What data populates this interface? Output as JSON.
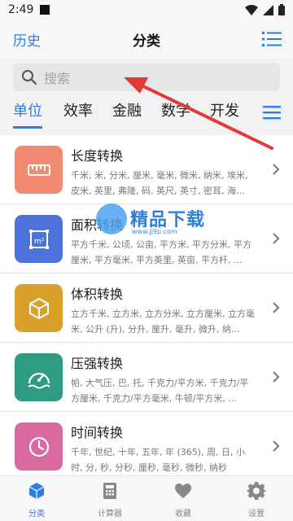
{
  "status": {
    "time": "2:49"
  },
  "header": {
    "history_label": "历史",
    "title": "分类",
    "list_icon": "list-icon"
  },
  "search": {
    "placeholder": "搜索"
  },
  "tabs": [
    "单位",
    "效率",
    "金融",
    "数学",
    "开发"
  ],
  "items": [
    {
      "title": "长度转换",
      "desc": "千米, 米, 分米, 厘米, 毫米, 微米, 纳米, 埃米, 皮米, 英里, 弗隆, 码, 英尺, 英寸, 密耳, 海...",
      "color": "#f08a72",
      "icon": "ruler-icon"
    },
    {
      "title": "面积转换",
      "desc": "平方千米, 公顷, 公亩, 平方米, 平方分米, 平方厘米, 平方毫米, 平方英里, 英亩, 平方杆, ...",
      "color": "#4d72d9",
      "icon": "area-icon"
    },
    {
      "title": "体积转换",
      "desc": "立方千米, 立方米, 立方分米, 立方厘米, 立方毫米, 公升 (升), 分升, 厘升, 毫升, 微升, 纳...",
      "color": "#d9a02b",
      "icon": "cube-icon"
    },
    {
      "title": "压强转换",
      "desc": "帕, 大气压, 巴, 托, 千克力/平方米, 千克力/平方厘米, 千克力/平方毫米, 牛顿/平方米, ...",
      "color": "#2e9c82",
      "icon": "gauge-icon"
    },
    {
      "title": "时间转换",
      "desc": "千年, 世纪, 十年, 五年, 年 (365), 周, 日, 小时, 分, 秒, 分秒, 厘秒, 毫秒, 微秒, 纳秒",
      "color": "#d9699f",
      "icon": "clock-icon"
    }
  ],
  "watermark": {
    "text": "精品下载",
    "url": "www.jj9p.com"
  },
  "nav": [
    {
      "label": "分类",
      "icon": "cube-icon"
    },
    {
      "label": "计算器",
      "icon": "calculator-icon"
    },
    {
      "label": "收藏",
      "icon": "heart-icon"
    },
    {
      "label": "设置",
      "icon": "gear-icon"
    }
  ],
  "colors": {
    "accent": "#2a7ee8",
    "arrow": "#e53935"
  }
}
